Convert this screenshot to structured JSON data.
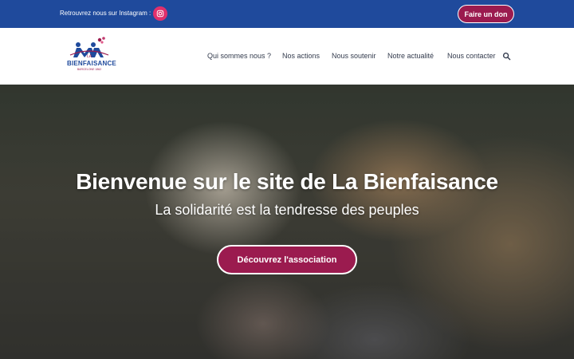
{
  "topbar": {
    "instagram_text": "Retrouvrez nous sur Instagram :",
    "donate_label": "Faire un don",
    "bg_color": "#1f4a9c",
    "accent_color": "#9b1b4f"
  },
  "logo": {
    "la": "LA",
    "name": "BIENFAISANCE",
    "sub": "BARCELONE 1862"
  },
  "nav": {
    "items": [
      {
        "label": "Qui sommes nous ?"
      },
      {
        "label": "Nos actions"
      },
      {
        "label": "Nous soutenir"
      },
      {
        "label": "Notre actualité"
      },
      {
        "label": "Nous contacter"
      }
    ],
    "search_icon": "search-icon"
  },
  "hero": {
    "title": "Bienvenue sur le site de La Bienfaisance",
    "subtitle": "La solidarité est la tendresse des peuples",
    "cta_label": "Découvrez l'association"
  }
}
